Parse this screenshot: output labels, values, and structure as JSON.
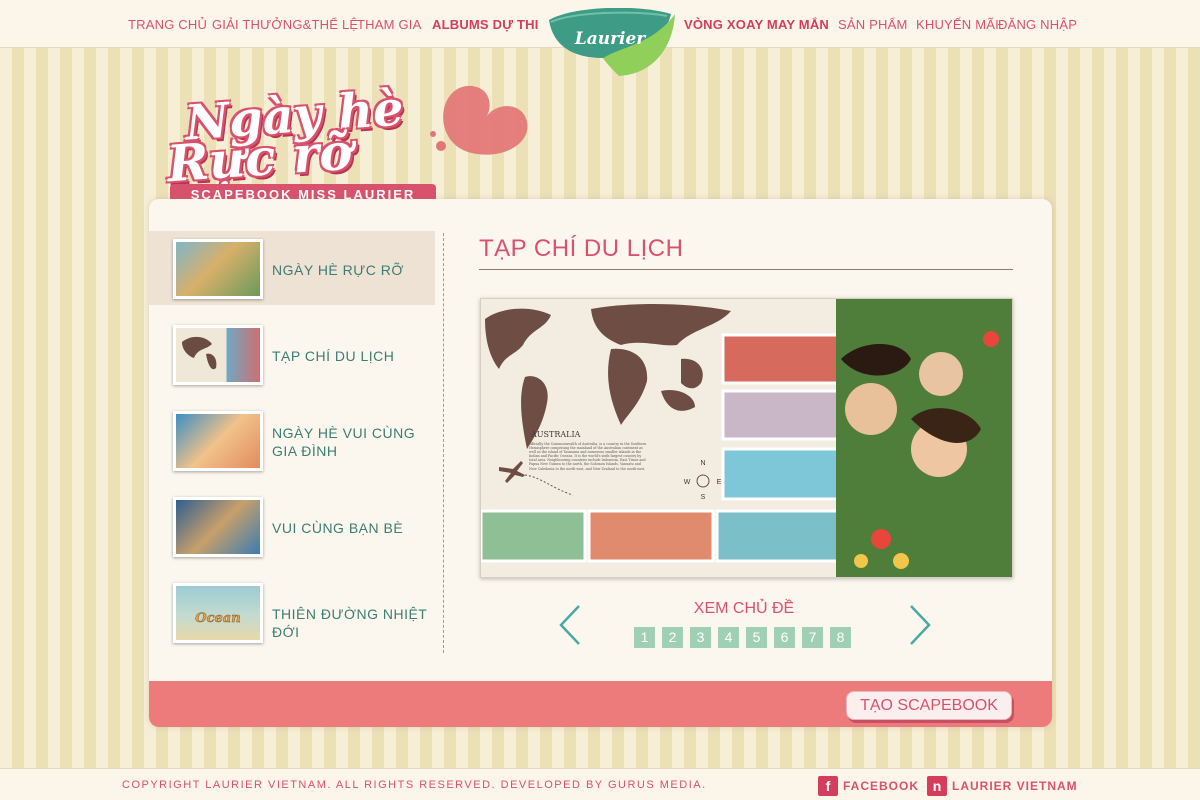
{
  "nav": {
    "items": [
      {
        "label": "TRANG CHỦ"
      },
      {
        "label": "GIẢI THƯỞNG&THỂ LỆ"
      },
      {
        "label": "THAM GIA"
      },
      {
        "label": "ALBUMS DỰ THI"
      },
      {
        "label": "VÒNG XOAY MAY MẮN"
      },
      {
        "label": "SẢN  PHẨM"
      },
      {
        "label": "KHUYẾN MÃI"
      },
      {
        "label": "ĐĂNG NHẬP"
      }
    ],
    "logo_text": "Laurier"
  },
  "hero": {
    "line1": "Ngày hè",
    "line2": "Rực rỡ",
    "ribbon": "SCAPEBOOK MISS LAURIER"
  },
  "sidebar": {
    "items": [
      {
        "label": "NGÀY HÈ RỰC RỠ",
        "active": true
      },
      {
        "label": "TẠP CHÍ DU LỊCH",
        "active": false
      },
      {
        "label": "NGÀY HÈ VUI CÙNG GIA ĐÌNH",
        "active": false
      },
      {
        "label": "VUI CÙNG BẠN BÈ",
        "active": false
      },
      {
        "label": "THIÊN ĐƯỜNG NHIỆT ĐỚI",
        "active": false
      }
    ]
  },
  "main": {
    "title": "TẠP CHÍ DU LỊCH",
    "gallery_text": {
      "heading": "AUSTRALIA",
      "body": "officially the Commonwealth of Australia, is a country in the Southern Hemisphere comprising the mainland of the Australian continent as well as the island of Tasmania and numerous smaller islands in the Indian and Pacific Oceans. It is the world's sixth-largest country by total area. Neighbouring countries include Indonesia, East Timor and Papua New Guinea to the north, the Solomon Islands, Vanuatu and New Caledonia to the north-east, and New Zealand to the south-east.",
      "compass": {
        "n": "N",
        "w": "W",
        "e": "E",
        "s": "S"
      }
    },
    "view_label": "XEM CHỦ ĐỀ",
    "pages": [
      "1",
      "2",
      "3",
      "4",
      "5",
      "6",
      "7",
      "8"
    ],
    "create_button": "TẠO SCAPEBOOK"
  },
  "footer": {
    "copyright": "COPYRIGHT LAURIER VIETNAM. ALL RIGHTS RESERVED. DEVELOPED BY GURUS MEDIA.",
    "facebook": "FACEBOOK",
    "brand": "LAURIER VIETNAM"
  },
  "colors": {
    "accent": "#d9526d",
    "teal": "#3c7d73",
    "coral_bar": "#ee7b7b",
    "page_button": "#9fd0b3"
  }
}
